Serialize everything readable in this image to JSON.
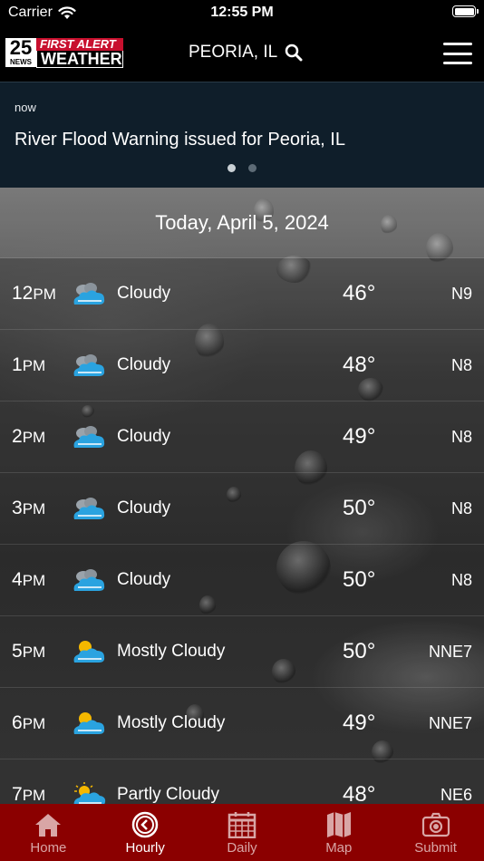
{
  "status": {
    "carrier": "Carrier",
    "time": "12:55 PM"
  },
  "header": {
    "logo_number": "25",
    "logo_news": "NEWS",
    "logo_first_alert": "FIRST ALERT",
    "logo_weather": "WEATHER",
    "location": "PEORIA, IL"
  },
  "alert": {
    "when": "now",
    "message": "River Flood Warning issued for Peoria, IL",
    "pages": 2,
    "active_page": 1
  },
  "date_heading": "Today, April 5, 2024",
  "hourly": [
    {
      "hour": "12",
      "ampm": "PM",
      "icon": "cloudy-icon",
      "condition": "Cloudy",
      "temp": "46°",
      "wind": "N9"
    },
    {
      "hour": "1",
      "ampm": "PM",
      "icon": "cloudy-icon",
      "condition": "Cloudy",
      "temp": "48°",
      "wind": "N8"
    },
    {
      "hour": "2",
      "ampm": "PM",
      "icon": "cloudy-icon",
      "condition": "Cloudy",
      "temp": "49°",
      "wind": "N8"
    },
    {
      "hour": "3",
      "ampm": "PM",
      "icon": "cloudy-icon",
      "condition": "Cloudy",
      "temp": "50°",
      "wind": "N8"
    },
    {
      "hour": "4",
      "ampm": "PM",
      "icon": "cloudy-icon",
      "condition": "Cloudy",
      "temp": "50°",
      "wind": "N8"
    },
    {
      "hour": "5",
      "ampm": "PM",
      "icon": "mostly-cloudy-icon",
      "condition": "Mostly Cloudy",
      "temp": "50°",
      "wind": "NNE7"
    },
    {
      "hour": "6",
      "ampm": "PM",
      "icon": "mostly-cloudy-icon",
      "condition": "Mostly Cloudy",
      "temp": "49°",
      "wind": "NNE7"
    },
    {
      "hour": "7",
      "ampm": "PM",
      "icon": "partly-cloudy-icon",
      "condition": "Partly Cloudy",
      "temp": "48°",
      "wind": "NE6"
    }
  ],
  "tabs": [
    {
      "label": "Home",
      "icon": "home-icon",
      "active": false
    },
    {
      "label": "Hourly",
      "icon": "clock-icon",
      "active": true
    },
    {
      "label": "Daily",
      "icon": "calendar-icon",
      "active": false
    },
    {
      "label": "Map",
      "icon": "map-icon",
      "active": false
    },
    {
      "label": "Submit",
      "icon": "camera-icon",
      "active": false
    }
  ],
  "colors": {
    "tabbar": "#8b0000",
    "alert_bg": "#0f1e2a",
    "brand_red": "#c8102e",
    "cloud_blue": "#2aa3e0",
    "sun_yellow": "#f5b800"
  }
}
